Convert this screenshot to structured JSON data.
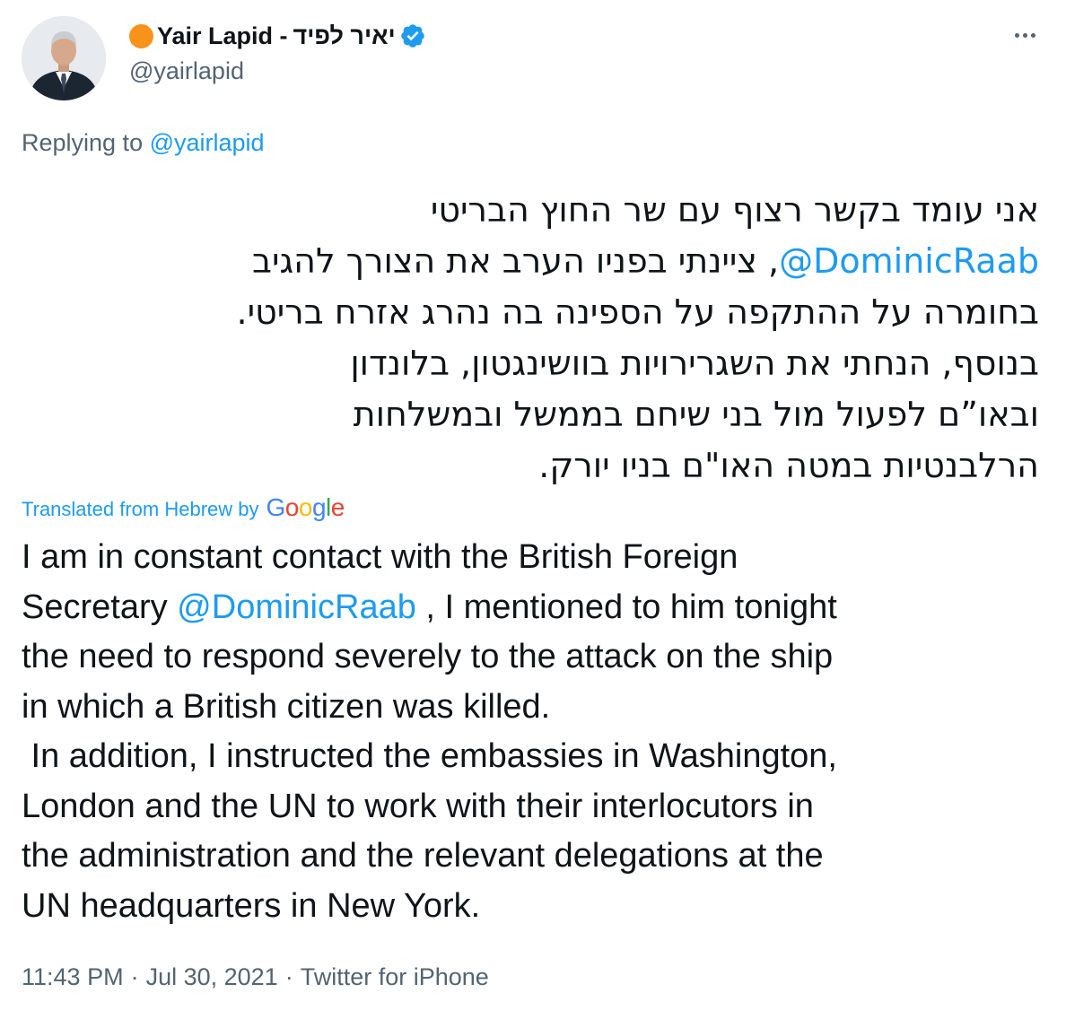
{
  "author": {
    "display_name": "Yair Lapid -",
    "hebrew_name": "יאיר לפיד",
    "handle": "@yairlapid",
    "avatar_icon": "person-avatar-icon",
    "status_dot_color": "#f7931a",
    "verified_icon": "verified-badge-icon",
    "verified_color": "#1d9bf0"
  },
  "more_icon": "more-options-icon",
  "replying": {
    "prefix": "Replying to ",
    "handle": "@yairlapid"
  },
  "hebrew_text": {
    "line1": "אני עומד בקשר רצוף עם שר החוץ הבריטי",
    "line2_mention": "@DominicRaab",
    "line2_text": ", ציינתי בפניו הערב את הצורך להגיב",
    "line3": "בחומרה על ההתקפה על הספינה בה נהרג אזרח בריטי.",
    "line4": "בנוסף, הנחתי את השגרירויות בוושינגטון, בלונדון",
    "line5": "ובאו”ם לפעול מול בני שיחם בממשל ובמשלחות",
    "line6": "הרלבנטיות במטה האו\"ם בניו יורק."
  },
  "translation": {
    "label": "Translated from Hebrew by",
    "provider": "Google",
    "provider_letters": [
      "G",
      "o",
      "o",
      "g",
      "l",
      "e"
    ]
  },
  "english_text": {
    "line1": "I am in constant contact with the British Foreign",
    "line2_pre": "Secretary ",
    "line2_mention": "@DominicRaab",
    "line2_post": " , I mentioned to him tonight",
    "line3": "the need to respond severely to the attack on the ship",
    "line4": "in which a British citizen was killed.",
    "line5": " In addition, I instructed the embassies in Washington,",
    "line6": "London and the UN to work with their interlocutors in",
    "line7": "the administration and the relevant delegations at the",
    "line8": "UN headquarters in New York."
  },
  "meta": {
    "time": "11:43 PM",
    "date": "Jul 30, 2021",
    "source": "Twitter for iPhone",
    "separator": "·"
  },
  "colors": {
    "link": "#1d9bf0",
    "secondary_text": "#536471",
    "primary_text": "#0f1419"
  }
}
